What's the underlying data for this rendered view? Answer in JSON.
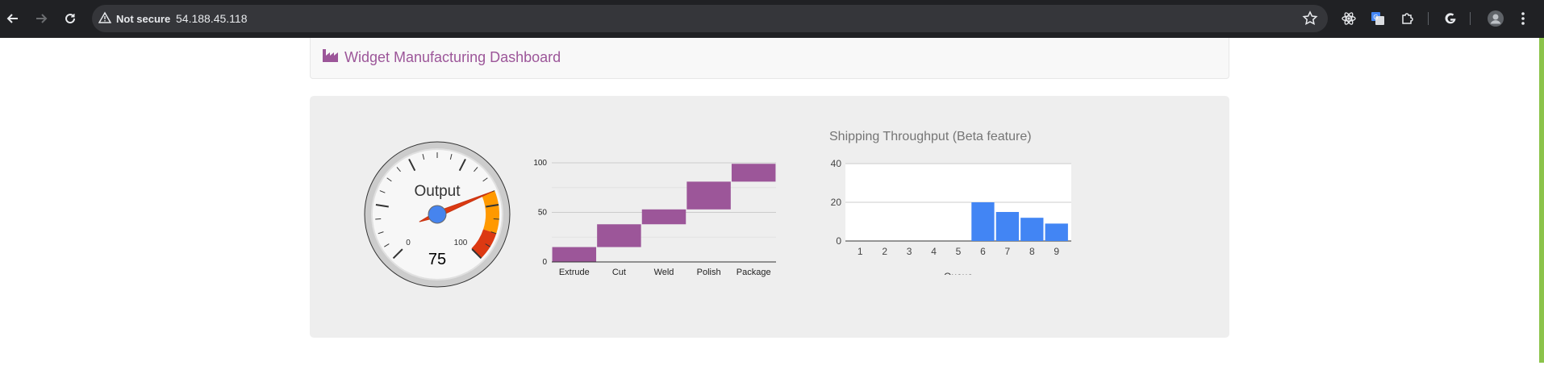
{
  "browser": {
    "security_label": "Not secure",
    "url": "54.188.45.118",
    "icons": [
      "back-icon",
      "forward-icon",
      "reload-icon",
      "warning-icon",
      "star-icon",
      "react-devtools-icon",
      "google-translate-icon",
      "extensions-icon",
      "google-icon",
      "profile-avatar-icon",
      "menu-dots-icon"
    ]
  },
  "header": {
    "icon": "factory-icon",
    "title": "Widget Manufacturing Dashboard",
    "accent_color": "#9c5699"
  },
  "gauge": {
    "label": "Output",
    "value": 75,
    "min_label": "0",
    "max_label": "100"
  },
  "waterfall": {
    "chart_data": {
      "type": "bar",
      "categories": [
        "Extrude",
        "Cut",
        "Weld",
        "Polish",
        "Package"
      ],
      "ranges": [
        [
          0,
          15
        ],
        [
          15,
          38
        ],
        [
          38,
          53
        ],
        [
          53,
          81
        ],
        [
          81,
          99
        ]
      ],
      "ylim": [
        0,
        100
      ],
      "yticks": [
        0,
        50,
        100
      ],
      "color": "#9c5699",
      "grid": true
    }
  },
  "shipping": {
    "title": "Shipping Throughput (Beta feature)",
    "chart_data": {
      "type": "bar",
      "categories": [
        "1",
        "2",
        "3",
        "4",
        "5",
        "6",
        "7",
        "8",
        "9"
      ],
      "values": [
        0,
        0,
        0,
        0,
        0,
        20,
        15,
        12,
        9
      ],
      "xlabel": "Queue",
      "ylim": [
        0,
        40
      ],
      "yticks": [
        0,
        20,
        40
      ],
      "color": "#4285f4",
      "grid": true
    }
  }
}
